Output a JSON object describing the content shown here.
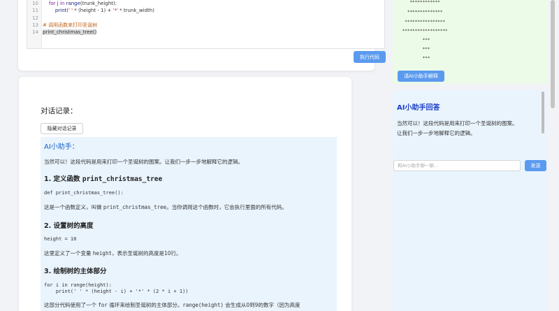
{
  "editor": {
    "lines": [
      {
        "n": "10",
        "parts": [
          {
            "t": "    "
          },
          {
            "t": "for",
            "c": "kw"
          },
          {
            "t": " j "
          },
          {
            "t": "in",
            "c": "kw"
          },
          {
            "t": " "
          },
          {
            "t": "range",
            "c": "fn"
          },
          {
            "t": "(trunk_height):"
          }
        ]
      },
      {
        "n": "11",
        "parts": [
          {
            "t": "        "
          },
          {
            "t": "print",
            "c": "fn"
          },
          {
            "t": "("
          },
          {
            "t": "' '",
            "c": "str"
          },
          {
            "t": " * (height - 1) + "
          },
          {
            "t": "'*'",
            "c": "str"
          },
          {
            "t": " * trunk_width)"
          }
        ]
      },
      {
        "n": "12",
        "parts": []
      },
      {
        "n": "13",
        "parts": [
          {
            "t": "# 调用函数来打印圣诞树",
            "c": "cmt"
          }
        ]
      },
      {
        "n": "14",
        "parts": [
          {
            "t": "print_christmas_tree()",
            "c": "hl"
          }
        ]
      }
    ],
    "run_label": "执行代码"
  },
  "chat": {
    "title": "对话记录：",
    "hide_label": "隐藏对话记录",
    "ai_name": "AI小助手：",
    "intro": "当然可以！这段代码是用来打印一个圣诞树的图案。让我们一步一步地解释它的逻辑。",
    "h1_prefix": "1. 定义函数 ",
    "h1_code": "print_christmas_tree",
    "code1": "def print_christmas_tree():",
    "p1_a": "这是一个函数定义，叫做 ",
    "p1_code": "print_christmas_tree",
    "p1_b": "。当你调用这个函数时，它会执行里面的所有代码。",
    "h2": "2. 设置树的高度",
    "code2": "height = 10",
    "p2_a": "这里定义了一个变量 ",
    "p2_code": "height",
    "p2_b": "，表示圣诞树的高度是10行。",
    "h3": "3. 绘制树的主体部分",
    "code3": "for i in range(height):\n    print(' ' * (height - i) + '*' * (2 * i + 1))",
    "p3_a": "这部分代码使用了一个 ",
    "p3_code1": "for",
    "p3_b": " 循环来绘制圣诞树的主体部分。",
    "p3_code2": "range(height)",
    "p3_c": " 会生成从0到9的数字（因为高度"
  },
  "output": {
    "tree_lines": [
      "    ************",
      "   **************",
      "  ****************",
      " ******************",
      "         ***",
      "         ***",
      "         ***"
    ],
    "explain_label": "请AI小助手解释"
  },
  "reply": {
    "title": "AI小助手回答",
    "line1": "当然可以！这段代码是用来打印一个圣诞树的图案。",
    "line2": "让我们一步一步地解释它的逻辑。"
  },
  "input": {
    "placeholder": "和AI小助手聊一聊...",
    "send_label": "发送"
  }
}
